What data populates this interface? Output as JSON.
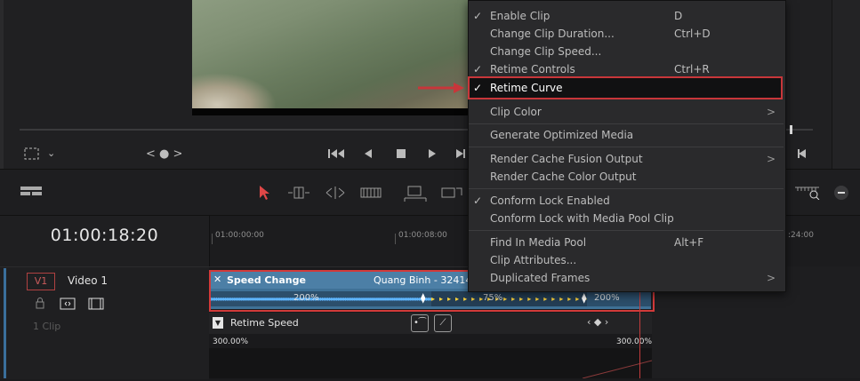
{
  "viewer": {
    "nav_dots": "< ● >"
  },
  "toolbar": {},
  "timeline": {
    "timecode": "01:00:18:20",
    "ruler_labels": [
      "01:00:00:00",
      "01:00:08:00",
      ":24:00"
    ],
    "track": {
      "badge": "V1",
      "name": "Video 1",
      "clip_count": "1 Clip"
    },
    "clip": {
      "title": "Speed Change",
      "name": "Quang Binh - 32414",
      "speeds": [
        "200%",
        "75%",
        "200%"
      ]
    },
    "retime": {
      "label": "Retime Speed",
      "left_pct": "300.00%",
      "right_pct": "300.00%"
    }
  },
  "context_menu": {
    "items": [
      {
        "label": "Enable Clip",
        "shortcut": "D",
        "checked": true
      },
      {
        "label": "Change Clip Duration...",
        "shortcut": "Ctrl+D",
        "checked": false
      },
      {
        "label": "Change Clip Speed...",
        "shortcut": "",
        "checked": false
      },
      {
        "label": "Retime Controls",
        "shortcut": "Ctrl+R",
        "checked": true
      },
      {
        "label": "Retime Curve",
        "shortcut": "",
        "checked": true,
        "highlighted": true
      },
      {
        "label": "Clip Color",
        "shortcut": "",
        "submenu": true
      },
      {
        "label": "Generate Optimized Media",
        "shortcut": ""
      },
      {
        "label": "Render Cache Fusion Output",
        "shortcut": "",
        "submenu": true
      },
      {
        "label": "Render Cache Color Output",
        "shortcut": ""
      },
      {
        "label": "Conform Lock Enabled",
        "shortcut": "",
        "checked": true
      },
      {
        "label": "Conform Lock with Media Pool Clip",
        "shortcut": ""
      },
      {
        "label": "Find In Media Pool",
        "shortcut": "Alt+F"
      },
      {
        "label": "Clip Attributes...",
        "shortcut": ""
      },
      {
        "label": "Duplicated Frames",
        "shortcut": "",
        "submenu": true
      }
    ],
    "check_glyph": "✓",
    "submenu_glyph": ">"
  },
  "colors": {
    "highlight_border": "#c8363a",
    "clip_blue": "#4c7fa6",
    "playhead": "#c23c3c"
  }
}
